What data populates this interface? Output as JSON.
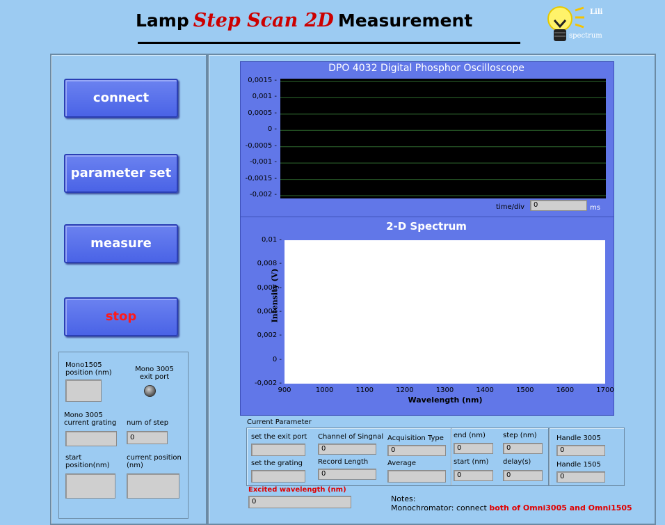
{
  "header": {
    "title_a": "Lamp",
    "title_b": "Step Scan 2D",
    "title_c": "Measurement",
    "logo_name": "lightbulb-icon",
    "logo_text_a": "Lili",
    "logo_text_b": "spectrum"
  },
  "controls": {
    "connect": "connect",
    "parameter_set": "parameter set",
    "measure": "measure",
    "stop": "stop"
  },
  "mono": {
    "mono1505_label": "Mono1505 position (nm)",
    "mono3005_exit_label": "Mono 3005 exit port",
    "mono3005_grating_label": "Mono 3005 current grating",
    "num_step_label": "num of step",
    "num_step_value": "0",
    "start_label": "start position(nm)",
    "current_label": "current position (nm)"
  },
  "oscilloscope": {
    "title": "DPO 4032 Digital Phosphor Oscilloscope",
    "y_ticks": [
      "0,0015",
      "0,001",
      "0,0005",
      "0",
      "-0,0005",
      "-0,001",
      "-0,0015",
      "-0,002"
    ],
    "time_div_label": "time/div",
    "time_div_value": "0",
    "time_unit": "ms"
  },
  "chart_data": [
    {
      "type": "line",
      "title": "DPO 4032 Digital Phosphor Oscilloscope",
      "ylim": [
        -0.002,
        0.0015
      ],
      "y_ticks": [
        "0,0015",
        "0,001",
        "0,0005",
        "0",
        "-0,0005",
        "-0,001",
        "-0,0015",
        "-0,002"
      ],
      "grid": true,
      "series": []
    },
    {
      "type": "line",
      "title": "2-D Spectrum",
      "xlabel": "Wavelength (nm)",
      "ylabel": "Intensity (V)",
      "xlim": [
        900,
        1700
      ],
      "ylim": [
        -0.002,
        0.01
      ],
      "x_ticks": [
        "900",
        "1000",
        "1100",
        "1200",
        "1300",
        "1400",
        "1500",
        "1600",
        "1700"
      ],
      "y_ticks": [
        "0,01",
        "0,008",
        "0,006",
        "0,004",
        "0,002",
        "0",
        "-0,002"
      ],
      "series": []
    }
  ],
  "params": {
    "section_label": "Current Parameter",
    "exit_port_label": "set the exit port",
    "grating_label": "set the grating",
    "channel_label": "Channel of Singnal",
    "channel_value": "0",
    "record_length_label": "Record Length",
    "record_length_value": "0",
    "acq_type_label": "Acquisition Type",
    "acq_type_value": "0",
    "average_label": "Average",
    "end_label": "end (nm)",
    "end_value": "0",
    "step_label": "step (nm)",
    "step_value": "0",
    "start_label": "start (nm)",
    "start_value": "0",
    "delay_label": "delay(s)",
    "delay_value": "0",
    "handle3005_label": "Handle 3005",
    "handle3005_value": "0",
    "handle1505_label": "Handle 1505",
    "handle1505_value": "0",
    "excited_label": "Excited wavelength (nm)",
    "excited_value": "0",
    "excited_color": "#e00000"
  },
  "notes": {
    "label": "Notes:",
    "line_prefix": "Monochromator:  connect ",
    "line_highlight": "both of Omni3005 and Omni1505",
    "highlight_color": "#e00000"
  }
}
